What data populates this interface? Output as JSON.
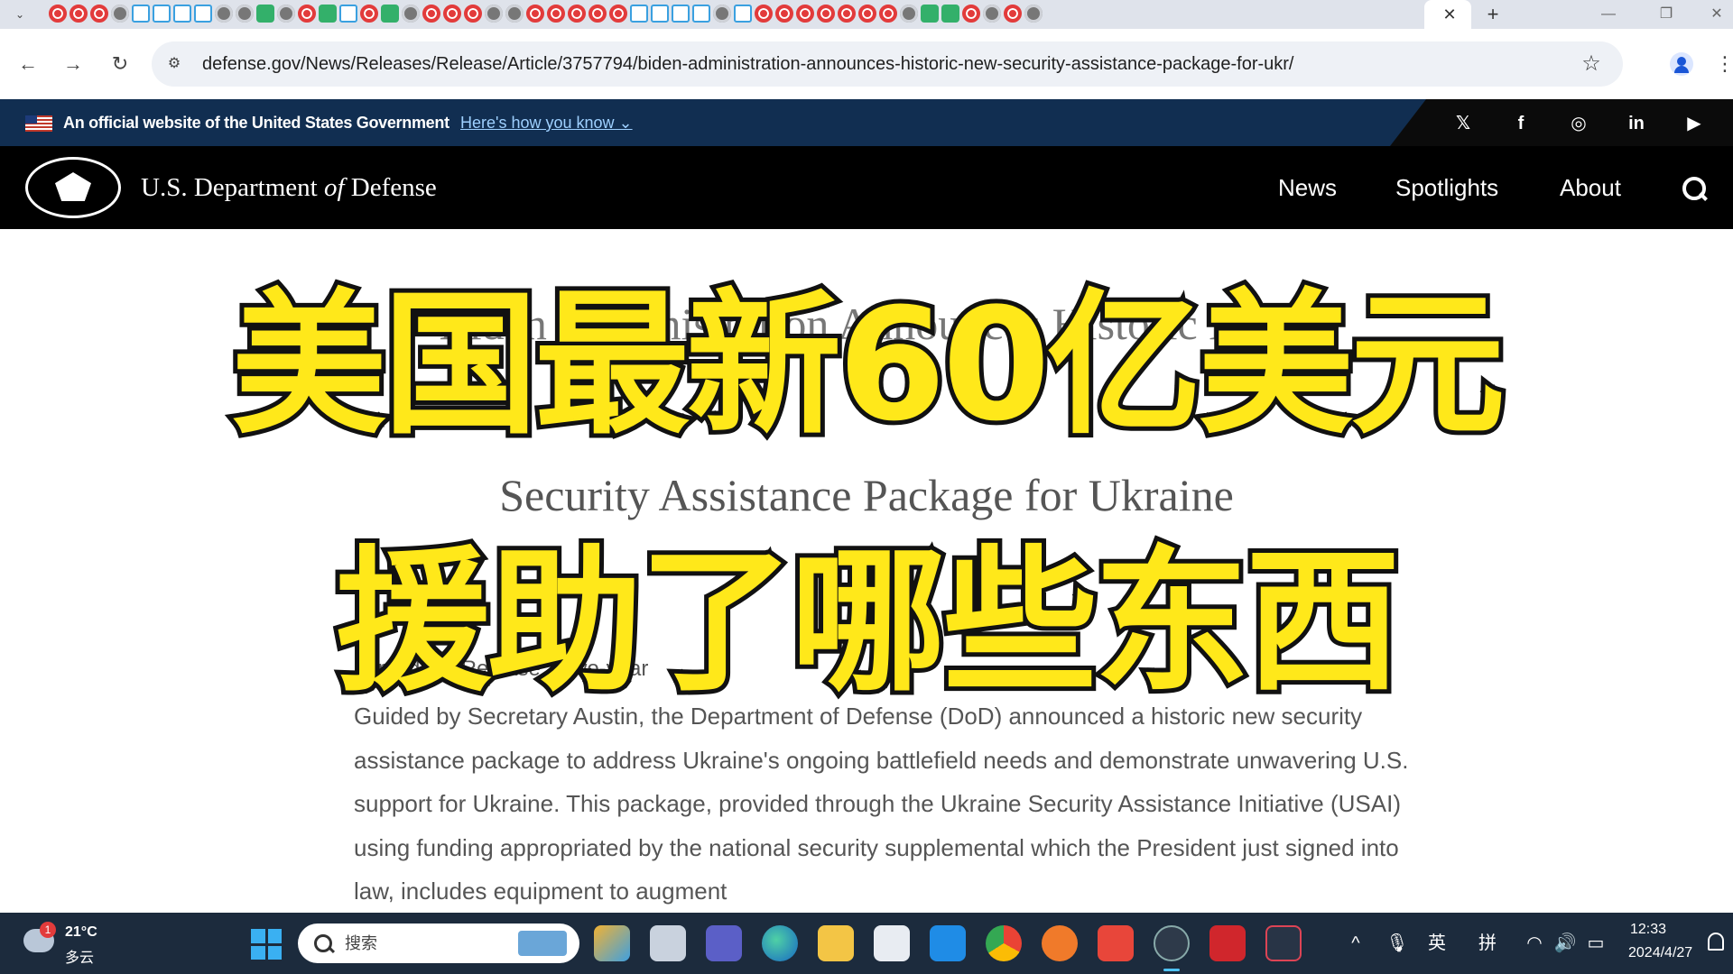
{
  "browser": {
    "tab_list_glyph": "⌄",
    "tab_close_glyph": "✕",
    "new_tab_glyph": "+",
    "window": {
      "minimize": "—",
      "restore": "❐",
      "close": "✕"
    },
    "nav": {
      "back": "←",
      "forward": "→",
      "reload": "↻"
    },
    "site_info_glyph": "⚙",
    "url": "defense.gov/News/Releases/Release/Article/3757794/biden-administration-announces-historic-new-security-assistance-package-for-ukr/",
    "bookmark_glyph": "☆",
    "menu_glyph": "⋮"
  },
  "gov_banner": {
    "text": "An official website of the United States Government",
    "link": "Here's how you know ⌄",
    "social": [
      "𝕏",
      "f",
      "◎",
      "in",
      "▶"
    ]
  },
  "site": {
    "title_pre": "U.S. Department ",
    "title_of": "of",
    "title_post": " Defense",
    "nav": [
      "News",
      "Spotlights",
      "About"
    ]
  },
  "article": {
    "title_line1": "Biden Administration Announces Historic New",
    "title_line2": "Security Assistance Package for Ukraine",
    "byline": "Immediate Release  ·  Two-year",
    "body": "Guided by Secretary Austin, the Department of Defense (DoD) announced a historic new security assistance package to address Ukraine's ongoing battlefield needs and demonstrate unwavering U.S. support for Ukraine. This package, provided through the Ukraine Security Assistance Initiative (USAI) using funding appropriated by the national security supplemental which the President just signed into law, includes equipment to augment"
  },
  "overlay": {
    "line1": "美国最新60亿美元",
    "line2": "援助了哪些东西"
  },
  "taskbar": {
    "weather_badge": "1",
    "temperature": "21°C",
    "condition": "多云",
    "search_placeholder": "搜索",
    "tray": {
      "chevron": "^",
      "mic": "🎙",
      "lang": "英",
      "ime": "拼",
      "wifi": "◠",
      "volume": "🔊",
      "battery": "▭"
    },
    "time": "12:33",
    "date": "2024/4/27"
  },
  "colors": {
    "gov_banner_bg": "#112e51",
    "header_bg": "#000000",
    "overlay_fill": "#ffe81a",
    "overlay_stroke": "#111111",
    "taskbar_bg": "#1c2b3d"
  }
}
